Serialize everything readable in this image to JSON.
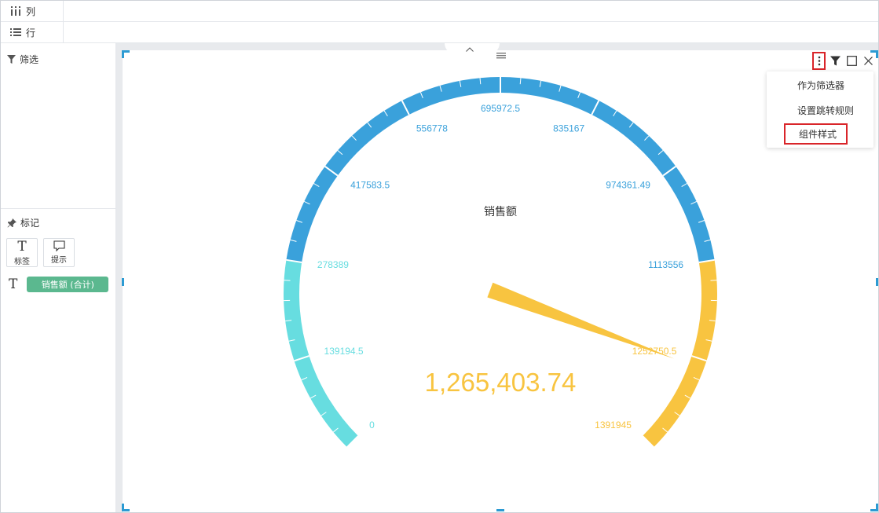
{
  "shelves": {
    "columns_label": "列",
    "rows_label": "行"
  },
  "left_panel": {
    "filter_title": "筛选",
    "mark_title": "标记",
    "mark_buttons": [
      {
        "glyph": "T",
        "label": "标签"
      },
      {
        "glyph": "",
        "label": "提示"
      }
    ],
    "field_glyph": "T",
    "field_pill": "销售额 (合计)"
  },
  "toolbar": {
    "more_icon": "more-vertical-icon",
    "filter_icon": "filter-icon",
    "maximize_icon": "square-icon",
    "close_icon": "close-icon"
  },
  "context_menu": {
    "items": [
      "作为筛选器",
      "设置跳转规则",
      "组件样式"
    ]
  },
  "chart_data": {
    "type": "gauge",
    "title": "销售额",
    "min": 0,
    "max": 1391945,
    "value": 1265403.74,
    "value_label": "1,265,403.74",
    "tick_labels": [
      "0",
      "139194.5",
      "278389",
      "417583.5",
      "556778",
      "695972.5",
      "835167",
      "974361.49",
      "1113556",
      "1252750.5",
      "1391945"
    ],
    "bands": [
      {
        "from": 0,
        "to": 0.2,
        "color": "#67dde0"
      },
      {
        "from": 0.2,
        "to": 0.8,
        "color": "#3aa1db"
      },
      {
        "from": 0.8,
        "to": 1.0,
        "color": "#f8c440"
      }
    ],
    "colors": {
      "low": "#67dde0",
      "mid": "#3aa1db",
      "high": "#f8c440",
      "title": "#333333",
      "pointer": "#f8c440"
    }
  },
  "accent": "#2c9bd3"
}
